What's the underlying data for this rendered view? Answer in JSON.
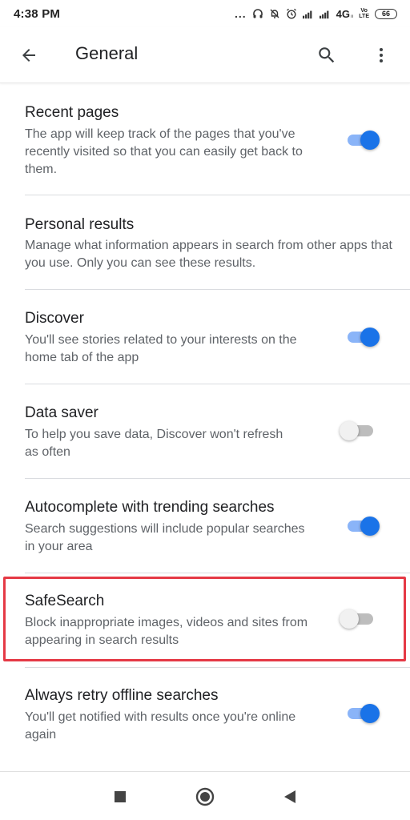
{
  "status_bar": {
    "time": "4:38 PM",
    "dots": "...",
    "network": "4G",
    "network_sub": "ıı",
    "volte_top": "Vo",
    "volte_bottom": "LTE",
    "battery": "66"
  },
  "app_bar": {
    "title": "General"
  },
  "settings": [
    {
      "title": "Recent pages",
      "description": "The app will keep track of the pages that you've recently visited so that you can easily get back to them.",
      "enabled": true
    },
    {
      "title": "Personal results",
      "description": "Manage what information appears in search from other apps that you use. Only you can see these results."
    },
    {
      "title": "Discover",
      "description": "You'll see stories related to your interests on the home tab of the app",
      "enabled": true
    },
    {
      "title": "Data saver",
      "description": "To help you save data, Discover won't refresh as often",
      "enabled": false
    },
    {
      "title": "Autocomplete with trending searches",
      "description": "Search suggestions will include popular searches in your area",
      "enabled": true
    },
    {
      "title": "SafeSearch",
      "description": "Block inappropriate images, videos and sites from appearing in search results",
      "enabled": false
    },
    {
      "title": "Always retry offline searches",
      "description": "You'll get notified with results once you're online again",
      "enabled": true
    }
  ],
  "colors": {
    "accent": "#1a73e8",
    "accent_track": "#8ab4f8",
    "highlight": "#e53945"
  },
  "icons": {
    "back": "arrow-back-icon",
    "search": "search-icon",
    "more": "more-vert-icon",
    "nav_recents": "square-icon",
    "nav_home": "circle-icon",
    "nav_back": "triangle-back-icon"
  }
}
